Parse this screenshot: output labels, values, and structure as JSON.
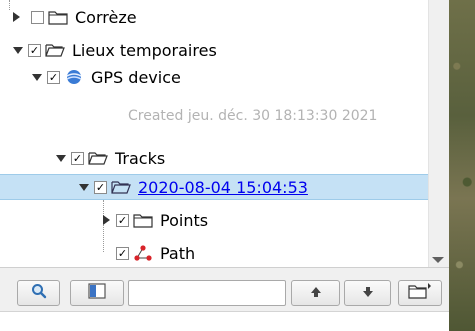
{
  "tree": {
    "items": [
      {
        "label": "Corrèze",
        "checked": false,
        "expanded": false
      },
      {
        "label": "Lieux temporaires",
        "checked": true,
        "expanded": true
      },
      {
        "label": "GPS device",
        "checked": true,
        "expanded": true,
        "meta": "Created jeu. déc. 30 18:13:30 2021"
      },
      {
        "label": "Tracks",
        "checked": true,
        "expanded": true
      },
      {
        "label": "2020-08-04 15:04:53",
        "checked": true,
        "expanded": true,
        "selected": true
      },
      {
        "label": "Points",
        "checked": true,
        "expanded": false
      },
      {
        "label": "Path",
        "checked": true
      }
    ]
  },
  "toolbar": {
    "search_value": "",
    "buttons": [
      "search-icon",
      "panel-toggle-icon",
      "move-up-icon",
      "move-down-icon",
      "folder-menu-icon"
    ]
  },
  "colors": {
    "selection": "#c5e1f5",
    "link": "#0000ee",
    "meta_text": "#b3b3b3"
  }
}
